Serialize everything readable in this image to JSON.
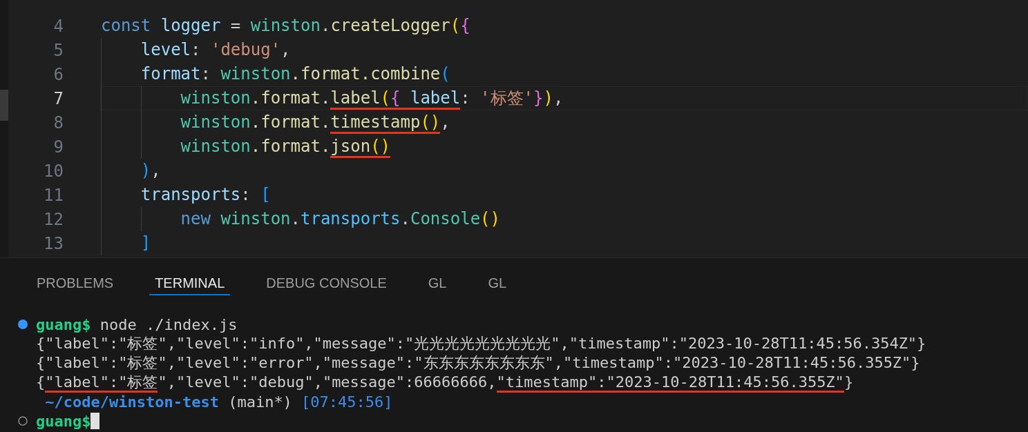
{
  "editor": {
    "lines": [
      {
        "number": "4",
        "current": false,
        "tokens": [
          {
            "kind": "kw",
            "text": "const "
          },
          {
            "kind": "var",
            "text": "logger"
          },
          {
            "kind": "p",
            "text": " = "
          },
          {
            "kind": "cls",
            "text": "winston"
          },
          {
            "kind": "p",
            "text": "."
          },
          {
            "kind": "fn",
            "text": "createLogger"
          },
          {
            "kind": "b1",
            "text": "("
          },
          {
            "kind": "b2",
            "text": "{"
          }
        ]
      },
      {
        "number": "5",
        "current": false,
        "tokens": [
          {
            "kind": "var",
            "text": "    level"
          },
          {
            "kind": "p",
            "text": ": "
          },
          {
            "kind": "str",
            "text": "'debug'"
          },
          {
            "kind": "p",
            "text": ","
          }
        ]
      },
      {
        "number": "6",
        "current": false,
        "tokens": [
          {
            "kind": "var",
            "text": "    format"
          },
          {
            "kind": "p",
            "text": ": "
          },
          {
            "kind": "cls",
            "text": "winston"
          },
          {
            "kind": "prop",
            "text": ".format."
          },
          {
            "kind": "fn",
            "text": "combine"
          },
          {
            "kind": "b3",
            "text": "("
          }
        ]
      },
      {
        "number": "7",
        "current": true,
        "tokens": [
          {
            "kind": "cls",
            "text": "        winston"
          },
          {
            "kind": "prop",
            "text": ".format."
          },
          {
            "kind": "fn",
            "text": "label",
            "underlined": true
          },
          {
            "kind": "b1",
            "text": "(",
            "underlined": true
          },
          {
            "kind": "b2",
            "text": "{ ",
            "underlined": true
          },
          {
            "kind": "var",
            "text": "label",
            "underlined": true
          },
          {
            "kind": "p",
            "text": ": "
          },
          {
            "kind": "str",
            "text": "'标签'"
          },
          {
            "kind": "b2",
            "text": "}"
          },
          {
            "kind": "b1",
            "text": ")"
          },
          {
            "kind": "p",
            "text": ","
          }
        ]
      },
      {
        "number": "8",
        "current": false,
        "tokens": [
          {
            "kind": "cls",
            "text": "        winston"
          },
          {
            "kind": "prop",
            "text": ".format."
          },
          {
            "kind": "fn",
            "text": "timestamp",
            "underlined": true
          },
          {
            "kind": "b1",
            "text": "()",
            "underlined": true
          },
          {
            "kind": "p",
            "text": ","
          }
        ]
      },
      {
        "number": "9",
        "current": false,
        "tokens": [
          {
            "kind": "cls",
            "text": "        winston"
          },
          {
            "kind": "prop",
            "text": ".format."
          },
          {
            "kind": "fn",
            "text": "json",
            "underlined": true
          },
          {
            "kind": "b1",
            "text": "()",
            "underlined": true
          }
        ]
      },
      {
        "number": "10",
        "current": false,
        "tokens": [
          {
            "kind": "b3",
            "text": "    )"
          },
          {
            "kind": "p",
            "text": ","
          }
        ]
      },
      {
        "number": "11",
        "current": false,
        "tokens": [
          {
            "kind": "var",
            "text": "    transports"
          },
          {
            "kind": "p",
            "text": ": "
          },
          {
            "kind": "b3",
            "text": "["
          }
        ]
      },
      {
        "number": "12",
        "current": false,
        "tokens": [
          {
            "kind": "kw",
            "text": "        new "
          },
          {
            "kind": "cls",
            "text": "winston"
          },
          {
            "kind": "p",
            "text": "."
          },
          {
            "kind": "var2",
            "text": "transports"
          },
          {
            "kind": "p",
            "text": "."
          },
          {
            "kind": "cls",
            "text": "Console"
          },
          {
            "kind": "b1",
            "text": "()"
          }
        ]
      },
      {
        "number": "13",
        "current": false,
        "tokens": [
          {
            "kind": "b3",
            "text": "    ]"
          }
        ]
      }
    ]
  },
  "panel": {
    "tabs": [
      {
        "label": "PROBLEMS",
        "selected": false
      },
      {
        "label": "TERMINAL",
        "selected": true
      },
      {
        "label": "DEBUG CONSOLE",
        "selected": false
      },
      {
        "label": "GL",
        "selected": false
      },
      {
        "label": "GL",
        "selected": false
      }
    ],
    "terminal": [
      {
        "kind": "prompt",
        "finished": true,
        "cursor": false,
        "segments": [
          {
            "kind": "user",
            "text": "guang$"
          },
          {
            "kind": "plain",
            "text": " node ./index.js"
          }
        ]
      },
      {
        "kind": "output",
        "segments": [
          {
            "kind": "plain",
            "text": "{\"label\":\"标签\",\"level\":\"info\",\"message\":\"光光光光光光光光光\",\"timestamp\":\"2023-10-28T11:45:56.354Z\"}"
          }
        ]
      },
      {
        "kind": "output",
        "segments": [
          {
            "kind": "plain",
            "text": "{\"label\":\"标签\",\"level\":\"error\",\"message\":\"东东东东东东东东\",\"timestamp\":\"2023-10-28T11:45:56.355Z\"}"
          }
        ]
      },
      {
        "kind": "output",
        "segments": [
          {
            "kind": "plain",
            "text": "{"
          },
          {
            "kind": "plain",
            "text": "\"label\":\"标签",
            "underlined": true
          },
          {
            "kind": "plain",
            "text": "\",\"level\":\"debug\",\"message\":66666666,"
          },
          {
            "kind": "plain",
            "text": "\"timestamp\":\"2023-10-28T11:45:56.355Z\"",
            "underlined": true
          },
          {
            "kind": "plain",
            "text": "}"
          }
        ]
      },
      {
        "kind": "output",
        "segments": [
          {
            "kind": "path",
            "text": " ~/code/winston-test"
          },
          {
            "kind": "plain",
            "text": " (main*)"
          },
          {
            "kind": "info",
            "text": " [07:45:56]"
          }
        ]
      },
      {
        "kind": "prompt",
        "finished": false,
        "cursor": true,
        "segments": [
          {
            "kind": "user",
            "text": "guang$"
          }
        ]
      }
    ]
  }
}
